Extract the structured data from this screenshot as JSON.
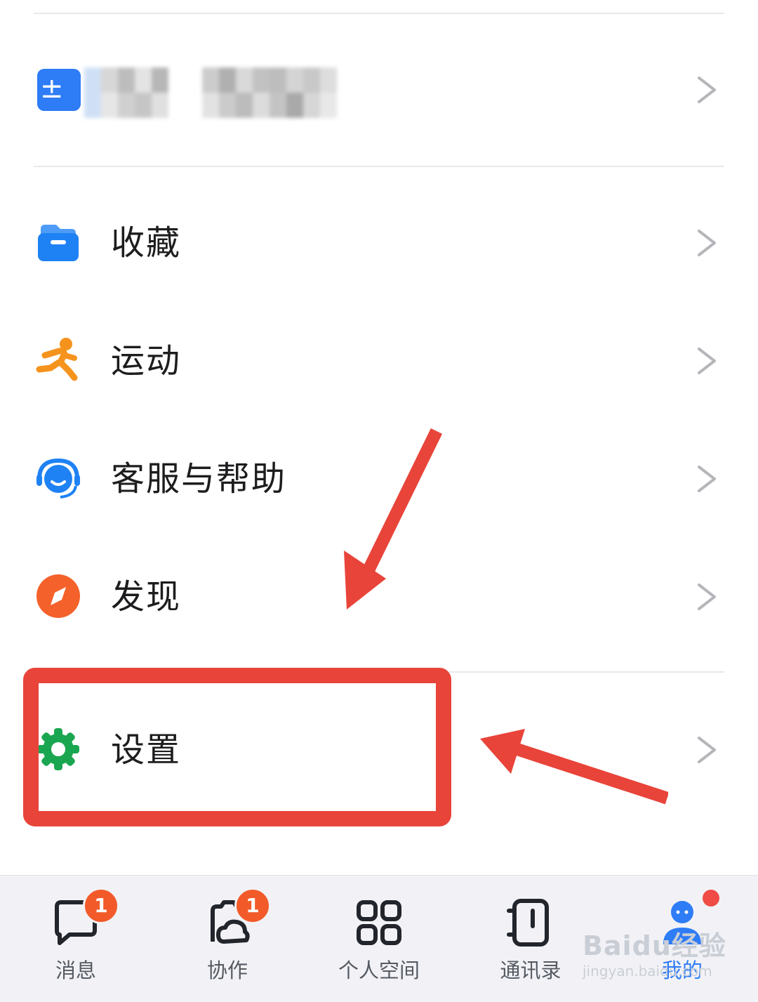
{
  "org": {
    "name_hidden": true
  },
  "menu": [
    {
      "id": "favorites",
      "label": "收藏",
      "icon": "folder-icon",
      "color": "#1e82f4"
    },
    {
      "id": "sports",
      "label": "运动",
      "icon": "running-person-icon",
      "color": "#f5931d"
    },
    {
      "id": "support",
      "label": "客服与帮助",
      "icon": "customer-service-icon",
      "color": "#1e82f4"
    },
    {
      "id": "discover",
      "label": "发现",
      "icon": "compass-icon",
      "color": "#f4612a"
    },
    {
      "id": "settings",
      "label": "设置",
      "icon": "gear-icon",
      "color": "#1aa650",
      "highlighted": true
    }
  ],
  "tabbar": {
    "tabs": [
      {
        "id": "messages",
        "label": "消息",
        "icon": "chat-bubble-icon",
        "badge": "1"
      },
      {
        "id": "collab",
        "label": "协作",
        "icon": "collaboration-icon",
        "badge": "1"
      },
      {
        "id": "space",
        "label": "个人空间",
        "icon": "grid-icon"
      },
      {
        "id": "contacts",
        "label": "通讯录",
        "icon": "address-book-icon"
      },
      {
        "id": "me",
        "label": "我的",
        "icon": "user-icon",
        "active": true,
        "dot": true
      }
    ]
  },
  "watermark": {
    "main": "Baidu经验",
    "sub": "jingyan.baidu.com"
  },
  "colors": {
    "accent": "#2e7cf6",
    "annotation": "#e8443a",
    "badge": "#f25a2a"
  }
}
